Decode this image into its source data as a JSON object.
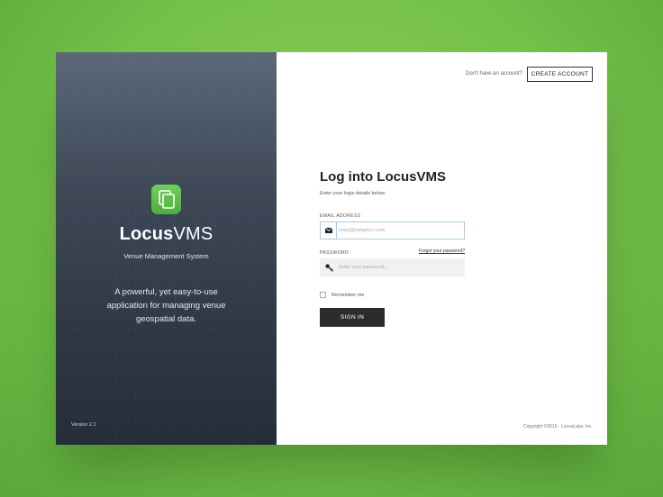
{
  "brand": {
    "name_bold": "Locus",
    "name_light": "VMS",
    "tagline": "Venue Management System",
    "description": "A powerful, yet easy-to-use application for managing venue geospatial data.",
    "version": "Version 2.1"
  },
  "header": {
    "account_question": "Don't have an account?",
    "create_account_label": "CREATE ACCOUNT"
  },
  "form": {
    "title": "Log into LocusVMS",
    "subtitle": "Enter your login details below.",
    "email_label": "EMAIL ADDRESS",
    "email_placeholder": "mary@widgetco.com",
    "email_value": "",
    "password_label": "PASSWORD",
    "password_placeholder": "Enter your password...",
    "password_value": "",
    "forgot_link": "Forgot your password?",
    "remember_label": "Remember me",
    "remember_checked": false,
    "signin_label": "SIGN IN"
  },
  "footer": {
    "copyright": "Copyright ©2016 · LocusLabs, Inc."
  },
  "colors": {
    "accent_green": "#5cbf48",
    "panel_dark": "#2f3847",
    "button_dark": "#2b2b2b",
    "input_focus": "#a9cbe6"
  },
  "icons": {
    "logo": "app-logo-icon",
    "email": "envelope-icon",
    "password": "key-icon"
  }
}
